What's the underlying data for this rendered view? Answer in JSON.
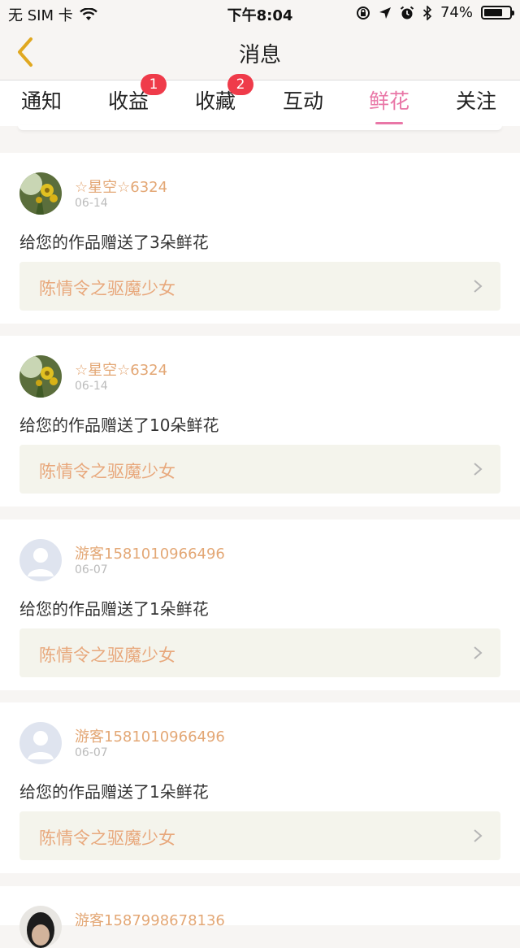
{
  "status_bar": {
    "carrier": "无 SIM 卡",
    "time": "下午8:04",
    "battery": "74%",
    "battery_level": 0.74
  },
  "header": {
    "title": "消息",
    "back_icon": "chevron-left-icon"
  },
  "tabs": [
    {
      "label": "通知",
      "badge": "",
      "active": false
    },
    {
      "label": "收益",
      "badge": "1",
      "active": false
    },
    {
      "label": "收藏",
      "badge": "2",
      "active": false
    },
    {
      "label": "互动",
      "badge": "",
      "active": false
    },
    {
      "label": "鲜花",
      "badge": "",
      "active": true
    },
    {
      "label": "关注",
      "badge": "",
      "active": false
    }
  ],
  "colors": {
    "accent": "#e977a7",
    "badge": "#ef3b4a",
    "username": "#e3a775",
    "work_title": "#e8a87c",
    "work_bg": "#f4f4ec"
  },
  "messages": [
    {
      "username": "☆星空☆6324",
      "date": "06-14",
      "text": "给您的作品赠送了3朵鲜花",
      "work_title": "陈情令之驱魔少女",
      "avatar": "flower-photo-avatar"
    },
    {
      "username": "☆星空☆6324",
      "date": "06-14",
      "text": "给您的作品赠送了10朵鲜花",
      "work_title": "陈情令之驱魔少女",
      "avatar": "flower-photo-avatar"
    },
    {
      "username": "游客1581010966496",
      "date": "06-07",
      "text": "给您的作品赠送了1朵鲜花",
      "work_title": "陈情令之驱魔少女",
      "avatar": "default-user-avatar"
    },
    {
      "username": "游客1581010966496",
      "date": "06-07",
      "text": "给您的作品赠送了1朵鲜花",
      "work_title": "陈情令之驱魔少女",
      "avatar": "default-user-avatar"
    },
    {
      "username": "游客1587998678136",
      "date": "",
      "text": "",
      "work_title": "",
      "avatar": "photo-avatar"
    }
  ]
}
